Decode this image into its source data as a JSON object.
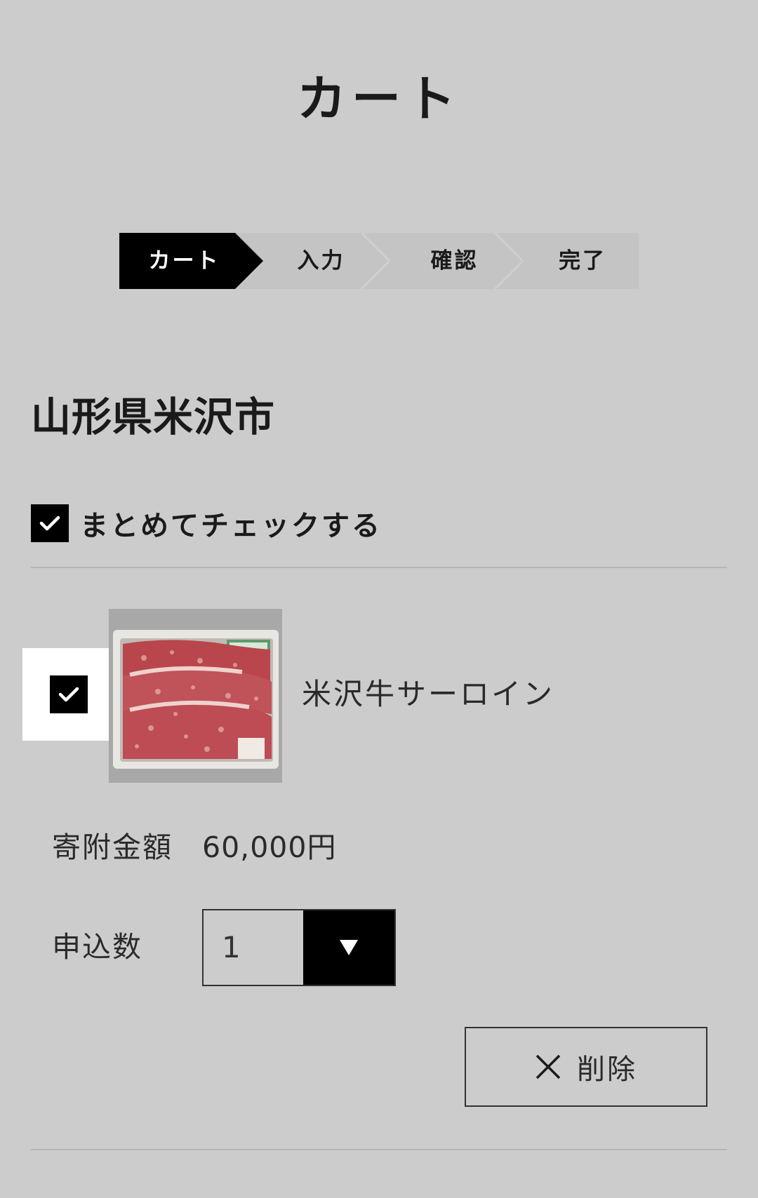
{
  "page": {
    "title": "カート"
  },
  "steps": [
    {
      "label": "カート",
      "active": true
    },
    {
      "label": "入力",
      "active": false
    },
    {
      "label": "確認",
      "active": false
    },
    {
      "label": "完了",
      "active": false
    }
  ],
  "municipality": {
    "name": "山形県米沢市",
    "check_all_label": "まとめてチェックする",
    "check_all_checked": true
  },
  "cart_item": {
    "checked": true,
    "image_icon": "beef-sirloin-image",
    "name": "米沢牛サーロイン",
    "price_label": "寄附金額",
    "price_value": "60,000円",
    "quantity_label": "申込数",
    "quantity_value": "1",
    "delete_label": "削除"
  },
  "colors": {
    "background": "#cccccc",
    "active_step": "#000000",
    "inactive_step": "#c4c4c4",
    "checkbox": "#000000"
  }
}
